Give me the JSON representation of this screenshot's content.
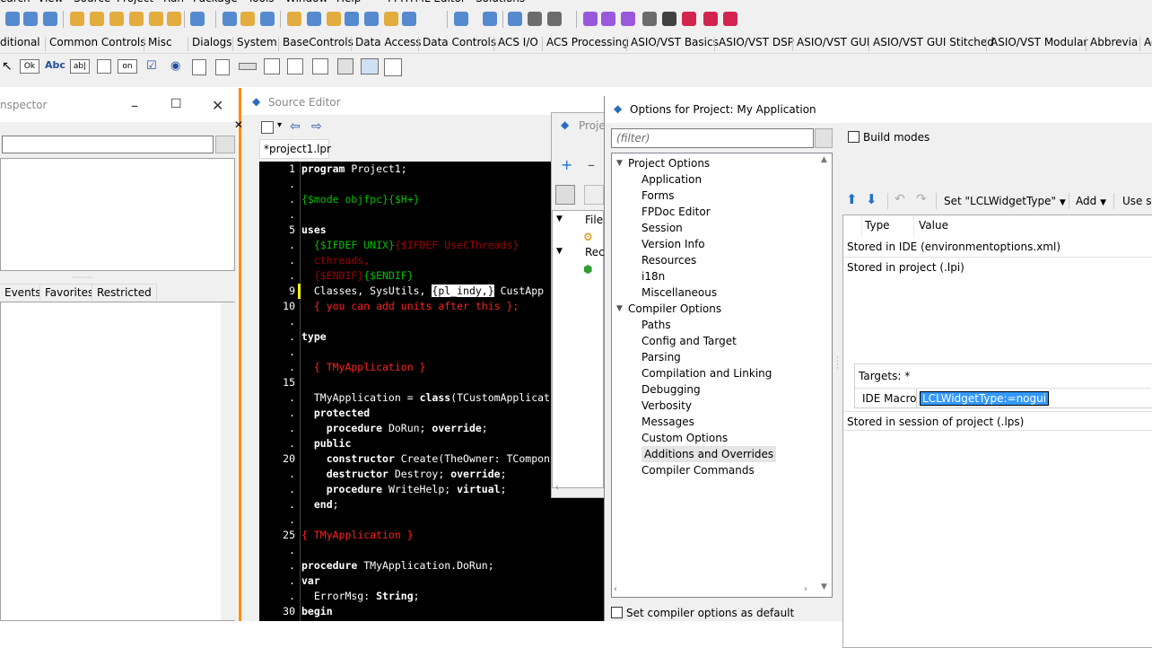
{
  "menu": [
    "earch",
    "View",
    "Source",
    "Project",
    "Run",
    "Package",
    "Tools",
    "Window",
    "Help",
    "FPHTML Editor",
    "Solutions"
  ],
  "palette_tabs": [
    "ditional",
    "Common Controls",
    "Misc",
    "Dialogs",
    "System",
    "BaseControls",
    "Data Access",
    "Data Controls",
    "ACS I/O",
    "ACS Processing",
    "ASIO/VST Basics",
    "ASIO/VST DSP",
    "ASIO/VST GUI",
    "ASIO/VST GUI Stitched",
    "ASIO/VST Modular",
    "Abbrevia",
    "Ac"
  ],
  "palette_components": {
    "button": "Ok",
    "label": "Abc",
    "edit": "ab|",
    "toggle": "on"
  },
  "inspector": {
    "title": "nspector",
    "tabs": [
      "Events",
      "Favorites",
      "Restricted"
    ]
  },
  "source_editor": {
    "title": "Source Editor",
    "tab": "*project1.lpr",
    "line_numbers": [
      "1",
      ".",
      ".",
      ".",
      "5",
      ".",
      ".",
      ".",
      "9",
      "10",
      ".",
      ".",
      ".",
      ".",
      "15",
      ".",
      ".",
      ".",
      ".",
      "20",
      ".",
      ".",
      ".",
      ".",
      "25",
      ".",
      ".",
      ".",
      ".",
      "30"
    ],
    "lines": [
      [
        {
          "t": "program",
          "c": "kw"
        },
        {
          "t": " Project1;",
          "c": ""
        }
      ],
      [],
      [
        {
          "t": "{$mode objfpc}{$H+}",
          "c": "dr"
        }
      ],
      [],
      [
        {
          "t": "uses",
          "c": "kw"
        }
      ],
      [
        {
          "t": "  {$IFDEF UNIX}",
          "c": "dr"
        },
        {
          "t": "{$IFDEF UseCThreads}",
          "c": "ds"
        }
      ],
      [
        {
          "t": "  cthreads,",
          "c": "ds"
        }
      ],
      [
        {
          "t": "  {$ENDIF}",
          "c": "ds"
        },
        {
          "t": "{$ENDIF}",
          "c": "dr"
        }
      ],
      [
        {
          "t": "  Classes, SysUtils, ",
          "c": ""
        },
        {
          "t": "{pl_indy,}",
          "c": "hl"
        },
        {
          "t": " CustApp",
          "c": ""
        }
      ],
      [
        {
          "t": "  { you can add units after this };",
          "c": "cm"
        }
      ],
      [],
      [
        {
          "t": "type",
          "c": "kw"
        }
      ],
      [],
      [
        {
          "t": "  { TMyApplication }",
          "c": "cm"
        }
      ],
      [],
      [
        {
          "t": "  TMyApplication = ",
          "c": ""
        },
        {
          "t": "class",
          "c": "kw"
        },
        {
          "t": "(TCustomApplicat",
          "c": ""
        }
      ],
      [
        {
          "t": "  protected",
          "c": "kw"
        }
      ],
      [
        {
          "t": "    ",
          "c": ""
        },
        {
          "t": "procedure",
          "c": "kw"
        },
        {
          "t": " DoRun; ",
          "c": ""
        },
        {
          "t": "override",
          "c": "kw"
        },
        {
          "t": ";",
          "c": ""
        }
      ],
      [
        {
          "t": "  public",
          "c": "kw"
        }
      ],
      [
        {
          "t": "    ",
          "c": ""
        },
        {
          "t": "constructor",
          "c": "kw"
        },
        {
          "t": " Create(TheOwner: TCompon",
          "c": ""
        }
      ],
      [
        {
          "t": "    ",
          "c": ""
        },
        {
          "t": "destructor",
          "c": "kw"
        },
        {
          "t": " Destroy; ",
          "c": ""
        },
        {
          "t": "override",
          "c": "kw"
        },
        {
          "t": ";",
          "c": ""
        }
      ],
      [
        {
          "t": "    ",
          "c": ""
        },
        {
          "t": "procedure",
          "c": "kw"
        },
        {
          "t": " WriteHelp; ",
          "c": ""
        },
        {
          "t": "virtual",
          "c": "kw"
        },
        {
          "t": ";",
          "c": ""
        }
      ],
      [
        {
          "t": "  end",
          "c": "kw"
        },
        {
          "t": ";",
          "c": ""
        }
      ],
      [],
      [
        {
          "t": "{ TMyApplication }",
          "c": "cm"
        }
      ],
      [],
      [
        {
          "t": "procedure",
          "c": "kw"
        },
        {
          "t": " TMyApplication.DoRun;",
          "c": ""
        }
      ],
      [
        {
          "t": "var",
          "c": "kw"
        }
      ],
      [
        {
          "t": "  ErrorMsg: ",
          "c": ""
        },
        {
          "t": "String",
          "c": "kw"
        },
        {
          "t": ";",
          "c": ""
        }
      ],
      [
        {
          "t": "begin",
          "c": "kw"
        }
      ]
    ]
  },
  "project_inspector": {
    "title": "Proje",
    "items": [
      "File",
      "Rec"
    ]
  },
  "options": {
    "title": "Options for Project: My Application",
    "filter_placeholder": "(filter)",
    "build_modes": "Build modes",
    "set_default": "Set compiler options as default",
    "tree": [
      {
        "label": "Project Options",
        "level": 0,
        "expanded": true
      },
      {
        "label": "Application",
        "level": 1
      },
      {
        "label": "Forms",
        "level": 1
      },
      {
        "label": "FPDoc Editor",
        "level": 1
      },
      {
        "label": "Session",
        "level": 1
      },
      {
        "label": "Version Info",
        "level": 1
      },
      {
        "label": "Resources",
        "level": 1
      },
      {
        "label": "i18n",
        "level": 1
      },
      {
        "label": "Miscellaneous",
        "level": 1
      },
      {
        "label": "Compiler Options",
        "level": 0,
        "expanded": true
      },
      {
        "label": "Paths",
        "level": 1
      },
      {
        "label": "Config and Target",
        "level": 1
      },
      {
        "label": "Parsing",
        "level": 1
      },
      {
        "label": "Compilation and Linking",
        "level": 1
      },
      {
        "label": "Debugging",
        "level": 1
      },
      {
        "label": "Verbosity",
        "level": 1
      },
      {
        "label": "Messages",
        "level": 1
      },
      {
        "label": "Custom Options",
        "level": 1
      },
      {
        "label": "Additions and Overrides",
        "level": 1,
        "selected": true
      },
      {
        "label": "Compiler Commands",
        "level": 1
      }
    ],
    "toolbar": {
      "set_label": "Set \"LCLWidgetType\"",
      "add_label": "Add",
      "use_label": "Use sy"
    },
    "grid": {
      "col_type": "Type",
      "col_value": "Value",
      "stored_ide": "Stored in IDE (environmentoptions.xml)",
      "stored_project": "Stored in project (.lpi)",
      "targets": "Targets: *",
      "macro_type": "IDE Macro",
      "macro_value": "LCLWidgetType:=nogui",
      "stored_session": "Stored in session of project (.lps)"
    }
  }
}
